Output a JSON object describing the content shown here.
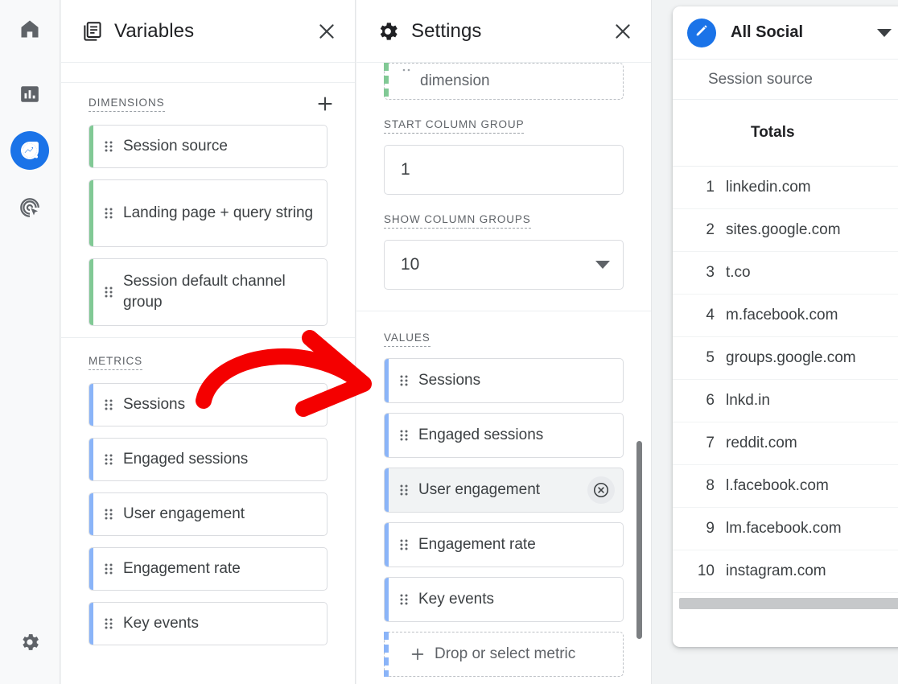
{
  "rail": {
    "items": [
      {
        "name": "home",
        "icon": "home-icon",
        "active": false
      },
      {
        "name": "reports",
        "icon": "bar-chart-icon",
        "active": false
      },
      {
        "name": "explore",
        "icon": "explore-icon",
        "active": true
      },
      {
        "name": "advertising",
        "icon": "target-cursor-icon",
        "active": false
      }
    ],
    "settings_icon": "gear-icon"
  },
  "variables_panel": {
    "title": "Variables",
    "icon": "library-books-icon",
    "close_label": "×",
    "dimensions": {
      "label": "DIMENSIONS",
      "add_label": "+",
      "items": [
        {
          "label": "Session source"
        },
        {
          "label": "Landing page + query string"
        },
        {
          "label": "Session default channel group"
        }
      ]
    },
    "metrics": {
      "label": "METRICS",
      "add_label": "+",
      "items": [
        {
          "label": "Sessions"
        },
        {
          "label": "Engaged sessions"
        },
        {
          "label": "User engagement"
        },
        {
          "label": "Engagement rate"
        },
        {
          "label": "Key events"
        }
      ]
    }
  },
  "settings_panel": {
    "title": "Settings",
    "icon": "gear-icon",
    "close_label": "×",
    "drop_dimension_label": "dimension",
    "start_column_group": {
      "label": "START COLUMN GROUP",
      "value": "1"
    },
    "show_column_groups": {
      "label": "SHOW COLUMN GROUPS",
      "value": "10"
    },
    "values": {
      "label": "VALUES",
      "items": [
        {
          "label": "Sessions",
          "selected": false
        },
        {
          "label": "Engaged sessions",
          "selected": false
        },
        {
          "label": "User engagement",
          "selected": true
        },
        {
          "label": "Engagement rate",
          "selected": false
        },
        {
          "label": "Key events",
          "selected": false
        }
      ],
      "add_label": "Drop or select metric",
      "add_plus": "+"
    }
  },
  "report": {
    "title": "All Social",
    "edit_icon": "pencil-icon",
    "caret_icon": "chevron-down-icon",
    "column_header": "Session source",
    "totals_label": "Totals",
    "rows": [
      {
        "index": "1",
        "value": "linkedin.com"
      },
      {
        "index": "2",
        "value": "sites.google.com"
      },
      {
        "index": "3",
        "value": "t.co"
      },
      {
        "index": "4",
        "value": "m.facebook.com"
      },
      {
        "index": "5",
        "value": "groups.google.com"
      },
      {
        "index": "6",
        "value": "lnkd.in"
      },
      {
        "index": "7",
        "value": "reddit.com"
      },
      {
        "index": "8",
        "value": "l.facebook.com"
      },
      {
        "index": "9",
        "value": "lm.facebook.com"
      },
      {
        "index": "10",
        "value": "instagram.com"
      }
    ]
  },
  "annotation": {
    "type": "curved-arrow",
    "color": "#f40000",
    "points_to": "values-sessions-chip"
  },
  "colors": {
    "accent_blue": "#1a73e8",
    "dimension_green": "#81c995",
    "metric_blue": "#8ab4f8",
    "annotation_red": "#f40000"
  }
}
